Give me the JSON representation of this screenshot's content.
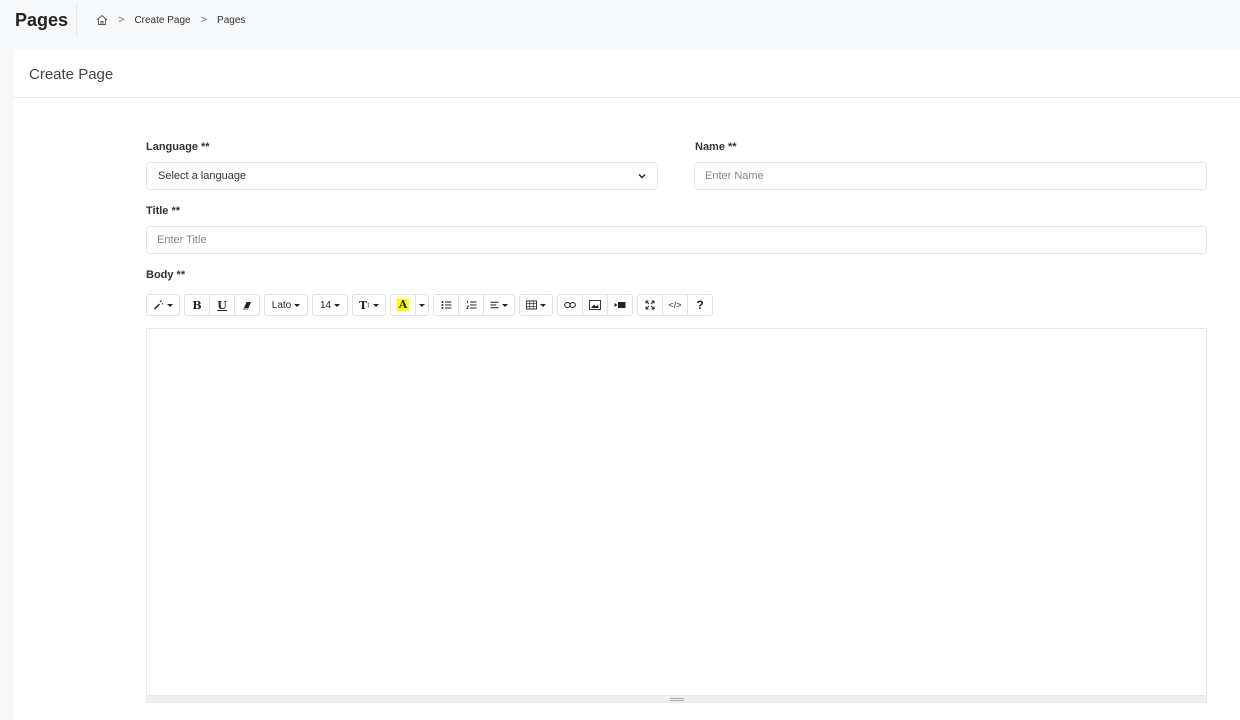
{
  "header": {
    "title": "Pages",
    "breadcrumb": [
      {
        "label": "Create Page"
      },
      {
        "label": "Pages"
      }
    ],
    "home_icon": "home-icon"
  },
  "card": {
    "title": "Create Page"
  },
  "form": {
    "language": {
      "label": "Language **",
      "selected": "Select a language"
    },
    "name": {
      "label": "Name **",
      "placeholder": "Enter Name"
    },
    "title": {
      "label": "Title **",
      "placeholder": "Enter Title"
    },
    "body": {
      "label": "Body **"
    }
  },
  "toolbar": {
    "font_family": "Lato",
    "font_size": "14",
    "bold": "B",
    "underline": "U",
    "text_size": "T",
    "color": "A",
    "help": "?",
    "code": "</>"
  },
  "colors": {
    "highlight": "#ffff00",
    "border": "#e2e5ea",
    "background": "#f7f8fa"
  }
}
